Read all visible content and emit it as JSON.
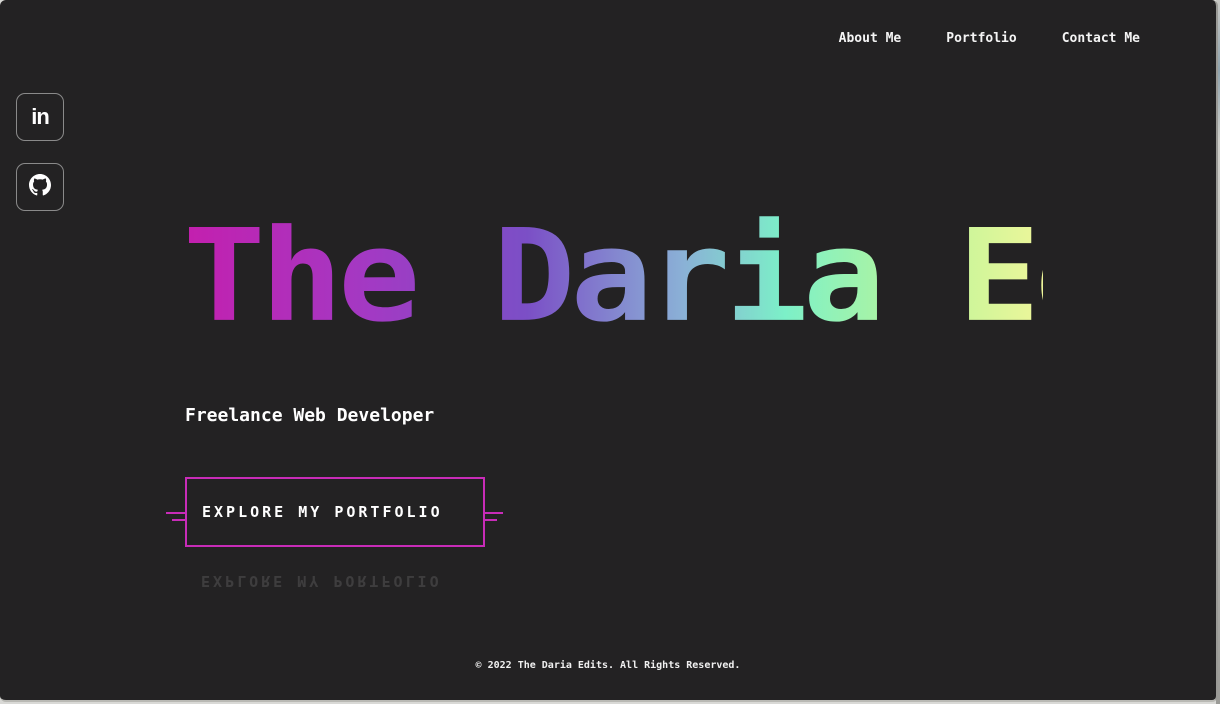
{
  "nav": {
    "items": [
      {
        "label": "About Me"
      },
      {
        "label": "Portfolio"
      },
      {
        "label": "Contact Me"
      }
    ]
  },
  "social": {
    "items": [
      {
        "icon": "linkedin-icon",
        "label": "in"
      },
      {
        "icon": "github-icon"
      }
    ]
  },
  "hero": {
    "title": "The Daria Edits",
    "subtitle": "Freelance Web Developer",
    "cta_label": "EXPLORE MY PORTFOLIO",
    "gradient_colors": [
      "#c41fae",
      "#a23ac4",
      "#7b4fc6",
      "#8ab0d6",
      "#7cf0c8",
      "#b8f59a",
      "#eef69a"
    ],
    "accent_color": "#c82cb8"
  },
  "footer": {
    "text": "© 2022 The Daria Edits. All Rights Reserved."
  },
  "theme": {
    "background": "#232223",
    "text": "#ffffff"
  }
}
